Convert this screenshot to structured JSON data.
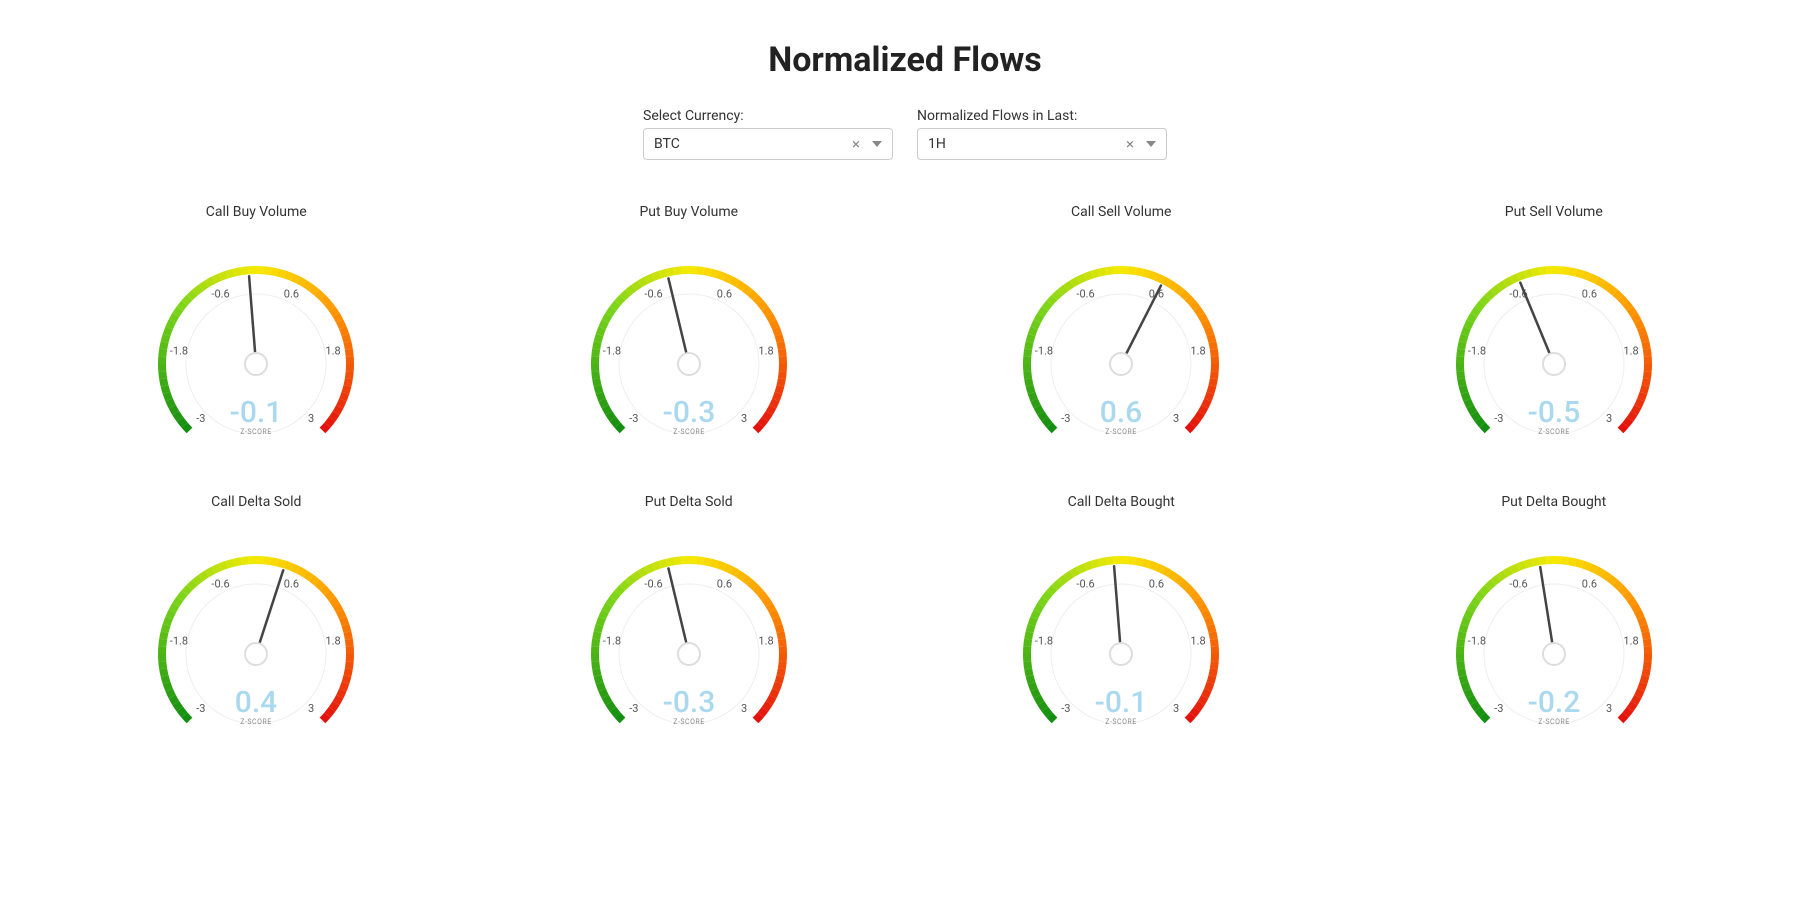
{
  "title": "Normalized Flows",
  "controls": {
    "currency": {
      "label": "Select Currency:",
      "value": "BTC"
    },
    "window": {
      "label": "Normalized Flows in Last:",
      "value": "1H"
    }
  },
  "gauge_meta": {
    "ticks": [
      -3,
      -1.8,
      -0.6,
      0.6,
      1.8,
      3
    ],
    "range": [
      -3,
      3
    ],
    "unit_label": "Z-SCORE"
  },
  "gauges": [
    {
      "title": "Call Buy Volume",
      "value": -0.1
    },
    {
      "title": "Put Buy Volume",
      "value": -0.3
    },
    {
      "title": "Call Sell Volume",
      "value": 0.6
    },
    {
      "title": "Put Sell Volume",
      "value": -0.5
    },
    {
      "title": "Call Delta Sold",
      "value": 0.4
    },
    {
      "title": "Put Delta Sold",
      "value": -0.3
    },
    {
      "title": "Call Delta Bought",
      "value": -0.1
    },
    {
      "title": "Put Delta Bought",
      "value": -0.2
    }
  ],
  "chart_data": [
    {
      "type": "gauge",
      "title": "Call Buy Volume",
      "value": -0.1,
      "range": [
        -3,
        3
      ],
      "ticks": [
        -3,
        -1.8,
        -0.6,
        0.6,
        1.8,
        3
      ],
      "unit": "Z-SCORE"
    },
    {
      "type": "gauge",
      "title": "Put Buy Volume",
      "value": -0.3,
      "range": [
        -3,
        3
      ],
      "ticks": [
        -3,
        -1.8,
        -0.6,
        0.6,
        1.8,
        3
      ],
      "unit": "Z-SCORE"
    },
    {
      "type": "gauge",
      "title": "Call Sell Volume",
      "value": 0.6,
      "range": [
        -3,
        3
      ],
      "ticks": [
        -3,
        -1.8,
        -0.6,
        0.6,
        1.8,
        3
      ],
      "unit": "Z-SCORE"
    },
    {
      "type": "gauge",
      "title": "Put Sell Volume",
      "value": -0.5,
      "range": [
        -3,
        3
      ],
      "ticks": [
        -3,
        -1.8,
        -0.6,
        0.6,
        1.8,
        3
      ],
      "unit": "Z-SCORE"
    },
    {
      "type": "gauge",
      "title": "Call Delta Sold",
      "value": 0.4,
      "range": [
        -3,
        3
      ],
      "ticks": [
        -3,
        -1.8,
        -0.6,
        0.6,
        1.8,
        3
      ],
      "unit": "Z-SCORE"
    },
    {
      "type": "gauge",
      "title": "Put Delta Sold",
      "value": -0.3,
      "range": [
        -3,
        3
      ],
      "ticks": [
        -3,
        -1.8,
        -0.6,
        0.6,
        1.8,
        3
      ],
      "unit": "Z-SCORE"
    },
    {
      "type": "gauge",
      "title": "Call Delta Bought",
      "value": -0.1,
      "range": [
        -3,
        3
      ],
      "ticks": [
        -3,
        -1.8,
        -0.6,
        0.6,
        1.8,
        3
      ],
      "unit": "Z-SCORE"
    },
    {
      "type": "gauge",
      "title": "Put Delta Bought",
      "value": -0.2,
      "range": [
        -3,
        3
      ],
      "ticks": [
        -3,
        -1.8,
        -0.6,
        0.6,
        1.8,
        3
      ],
      "unit": "Z-SCORE"
    }
  ]
}
